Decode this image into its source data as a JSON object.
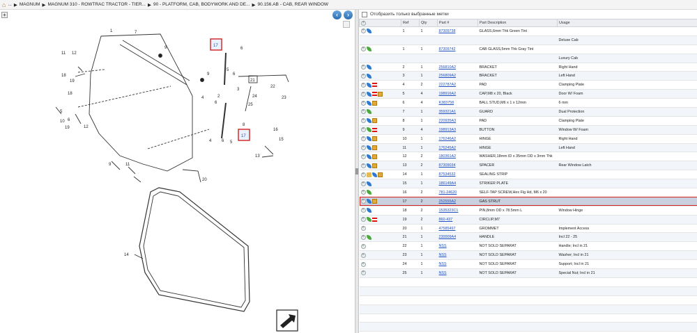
{
  "breadcrumb": {
    "items": [
      "...",
      "MAGNUM",
      "MAGNUM 310 - ROWTRAC TRACTOR - TIER...",
      "90 - PLATFORM, CAB, BODYWORK AND DE...",
      "90.156.AB - CAB, REAR WINDOW"
    ]
  },
  "nav": {
    "back_symbol": "‹",
    "forward_symbol": "›",
    "add_symbol": "+"
  },
  "filter": {
    "label": "Отобразить только выбранные метки"
  },
  "table": {
    "headers": [
      "",
      "Ref",
      "Qty",
      "Part #",
      "Part Description",
      "Usage"
    ],
    "rows": [
      {
        "icons": [
          "plus",
          "blue"
        ],
        "ref": "1",
        "qty": "1",
        "part": "87309738",
        "desc": "GLASS,6mm Thk Green Tint",
        "usage": ""
      },
      {
        "icons": [],
        "ref": "",
        "qty": "",
        "part": "",
        "desc": "",
        "usage": "Deluxe Cab"
      },
      {
        "icons": [
          "plus",
          "green"
        ],
        "ref": "1",
        "qty": "1",
        "part": "87309742",
        "desc": "CAB GLASS,5mm Thk Gray Tint",
        "usage": ""
      },
      {
        "icons": [],
        "ref": "",
        "qty": "",
        "part": "",
        "desc": "",
        "usage": "Luxury Cab"
      },
      {
        "icons": [
          "plus",
          "blue"
        ],
        "ref": "2",
        "qty": "1",
        "part": "256810A2",
        "desc": "BRACKET",
        "usage": "Right Hand"
      },
      {
        "icons": [
          "plus",
          "blue"
        ],
        "ref": "3",
        "qty": "1",
        "part": "256809A2",
        "desc": "BRACKET",
        "usage": "Left Hand"
      },
      {
        "icons": [
          "plus",
          "blue",
          "red"
        ],
        "ref": "4",
        "qty": "2",
        "part": "222787A2",
        "desc": "PAD",
        "usage": "Clamping Plate"
      },
      {
        "icons": [
          "plus",
          "blue",
          "red",
          "box"
        ],
        "ref": "5",
        "qty": "4",
        "part": "198916A2",
        "desc": "CAP,M8 x 20, Black",
        "usage": "Door W/ Foam"
      },
      {
        "icons": [
          "plus",
          "blue",
          "box"
        ],
        "ref": "6",
        "qty": "4",
        "part": "K383758",
        "desc": "BALL STUD,M6 x 1 x 12mm",
        "usage": "6 mm"
      },
      {
        "icons": [
          "plus",
          "green"
        ],
        "ref": "7",
        "qty": "1",
        "part": "359321A1",
        "desc": "GUARD",
        "usage": "Dual Protection"
      },
      {
        "icons": [
          "plus",
          "blue",
          "box"
        ],
        "ref": "8",
        "qty": "1",
        "part": "220935A3",
        "desc": "PAD",
        "usage": "Clamping Plate"
      },
      {
        "icons": [
          "plus",
          "green",
          "red"
        ],
        "ref": "9",
        "qty": "4",
        "part": "198913A3",
        "desc": "BUTTON",
        "usage": "Window W/ Foam"
      },
      {
        "icons": [
          "plus",
          "blue",
          "box"
        ],
        "ref": "10",
        "qty": "1",
        "part": "176246A2",
        "desc": "HINGE",
        "usage": "Right Hand"
      },
      {
        "icons": [
          "plus",
          "blue",
          "box"
        ],
        "ref": "11",
        "qty": "1",
        "part": "176245A2",
        "desc": "HINGE",
        "usage": "Left Hand"
      },
      {
        "icons": [
          "plus",
          "blue",
          "box"
        ],
        "ref": "12",
        "qty": "2",
        "part": "180361A2",
        "desc": "WASHER,18mm ID x 35mm OD x 3mm Thk",
        "usage": ""
      },
      {
        "icons": [
          "plus",
          "blue",
          "box"
        ],
        "ref": "13",
        "qty": "2",
        "part": "87309034",
        "desc": "SPACER",
        "usage": "Rear Window Latch"
      },
      {
        "icons": [
          "plus",
          "folder",
          "blue",
          "box"
        ],
        "ref": "14",
        "qty": "1",
        "part": "87534532",
        "desc": "SEALING STRIP",
        "usage": ""
      },
      {
        "icons": [
          "plus",
          "blue"
        ],
        "ref": "15",
        "qty": "1",
        "part": "186149A4",
        "desc": "STRIKER PLATE",
        "usage": ""
      },
      {
        "icons": [
          "plus",
          "green"
        ],
        "ref": "16",
        "qty": "2",
        "part": "781-24620",
        "desc": "SELF-TAP SCREW,Hex Flg Hd, M6 x 20",
        "usage": ""
      },
      {
        "icons": [
          "plus",
          "blue",
          "box"
        ],
        "ref": "17",
        "qty": "2",
        "part": "252555A2",
        "desc": "GAS STRUT",
        "usage": "",
        "selected": true
      },
      {
        "icons": [
          "plus",
          "blue"
        ],
        "ref": "18",
        "qty": "2",
        "part": "1535323C1",
        "desc": "PIN,8mm OD x 78.5mm L",
        "usage": "Window Hinge"
      },
      {
        "icons": [
          "plus",
          "green",
          "red"
        ],
        "ref": "19",
        "qty": "2",
        "part": "860-437",
        "desc": "CIRCLIP,M7",
        "usage": ""
      },
      {
        "icons": [
          "plus"
        ],
        "ref": "20",
        "qty": "1",
        "part": "47585497",
        "desc": "GROMMET",
        "usage": "Implement Access"
      },
      {
        "icons": [
          "plus",
          "green"
        ],
        "ref": "21",
        "qty": "1",
        "part": "230009A4",
        "desc": "HANDLE",
        "usage": "Incl 22 - 25"
      },
      {
        "icons": [
          "plus"
        ],
        "ref": "22",
        "qty": "1",
        "part": "NSS",
        "desc": "NOT SOLD SEPARAT",
        "usage": "Handle; Incl in 21"
      },
      {
        "icons": [
          "plus"
        ],
        "ref": "23",
        "qty": "1",
        "part": "NSS",
        "desc": "NOT SOLD SEPARAT",
        "usage": "Washer; Incl in 21"
      },
      {
        "icons": [
          "plus"
        ],
        "ref": "24",
        "qty": "1",
        "part": "NSS",
        "desc": "NOT SOLD SEPARAT",
        "usage": "Support; Incl in 21"
      },
      {
        "icons": [
          "plus"
        ],
        "ref": "25",
        "qty": "1",
        "part": "NSS",
        "desc": "NOT SOLD SEPARAT",
        "usage": "Special Nut; Incl in 21"
      }
    ],
    "empty_rows": 6
  },
  "diagram": {
    "callouts": [
      "1",
      "7",
      "9",
      "11",
      "12",
      "18",
      "19",
      "17",
      "6",
      "5",
      "3",
      "2",
      "4",
      "21",
      "22",
      "23",
      "24",
      "25",
      "10",
      "8",
      "16",
      "15",
      "13",
      "20",
      "14"
    ]
  }
}
